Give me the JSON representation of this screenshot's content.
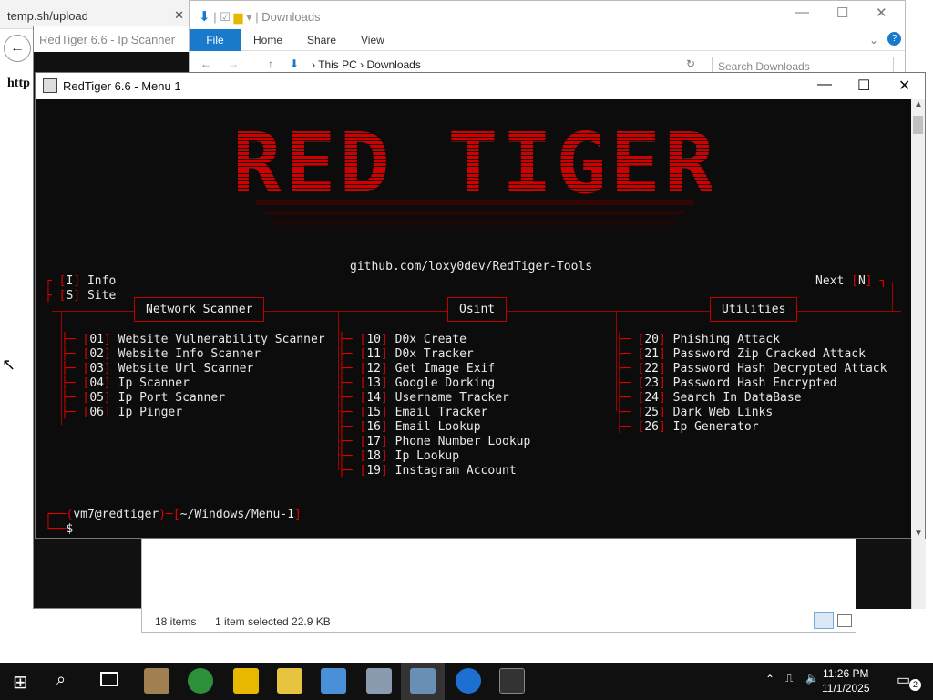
{
  "browser": {
    "tab_title": "temp.sh/upload",
    "page_text": "http"
  },
  "ipscanner": {
    "title": "RedTiger 6.6 - Ip Scanner"
  },
  "explorer": {
    "title": "Downloads",
    "ribbon": [
      "File",
      "Home",
      "Share",
      "View"
    ],
    "breadcrumb": [
      "This PC",
      "Downloads"
    ],
    "search_placeholder": "Search Downloads",
    "status_items": "18 items",
    "status_selected": "1 item selected  22.9 KB"
  },
  "terminal": {
    "title": "RedTiger 6.6 - Menu 1",
    "banner": "RED TIGER",
    "github": "github.com/loxy0dev/RedTiger-Tools",
    "info": {
      "key": "I",
      "label": "Info"
    },
    "site": {
      "key": "S",
      "label": "Site"
    },
    "next": {
      "label": "Next",
      "key": "N"
    },
    "categories": [
      {
        "label": "Network Scanner"
      },
      {
        "label": "Osint"
      },
      {
        "label": "Utilities"
      }
    ],
    "network": [
      {
        "num": "01",
        "label": "Website Vulnerability Scanner"
      },
      {
        "num": "02",
        "label": "Website Info Scanner"
      },
      {
        "num": "03",
        "label": "Website Url Scanner"
      },
      {
        "num": "04",
        "label": "Ip Scanner"
      },
      {
        "num": "05",
        "label": "Ip Port Scanner"
      },
      {
        "num": "06",
        "label": "Ip Pinger"
      }
    ],
    "osint": [
      {
        "num": "10",
        "label": "D0x Create"
      },
      {
        "num": "11",
        "label": "D0x Tracker"
      },
      {
        "num": "12",
        "label": "Get Image Exif"
      },
      {
        "num": "13",
        "label": "Google Dorking"
      },
      {
        "num": "14",
        "label": "Username Tracker"
      },
      {
        "num": "15",
        "label": "Email Tracker"
      },
      {
        "num": "16",
        "label": "Email Lookup"
      },
      {
        "num": "17",
        "label": "Phone Number Lookup"
      },
      {
        "num": "18",
        "label": "Ip Lookup"
      },
      {
        "num": "19",
        "label": "Instagram Account"
      }
    ],
    "utilities": [
      {
        "num": "20",
        "label": "Phishing Attack"
      },
      {
        "num": "21",
        "label": "Password Zip Cracked Attack"
      },
      {
        "num": "22",
        "label": "Password Hash Decrypted Attack"
      },
      {
        "num": "23",
        "label": "Password Hash Encrypted"
      },
      {
        "num": "24",
        "label": "Search In DataBase"
      },
      {
        "num": "25",
        "label": "Dark Web Links"
      },
      {
        "num": "26",
        "label": "Ip Generator"
      }
    ],
    "prompt_user": "vm7@redtiger",
    "prompt_path": "~/Windows/Menu-1",
    "prompt_symbol": "$"
  },
  "taskbar": {
    "time": "11:26 PM",
    "date": "11/1/2025",
    "notif_count": "2"
  },
  "colors": {
    "accent_red": "#e00000",
    "terminal_bg": "#0c0c0c",
    "explorer_file": "#1979ca"
  }
}
